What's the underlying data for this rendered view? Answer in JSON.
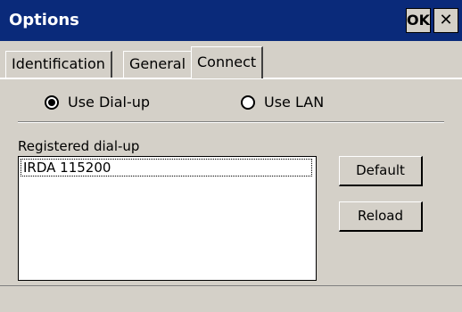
{
  "window": {
    "title": "Options",
    "ok_label": "OK",
    "close_label": "✕"
  },
  "tabs": [
    {
      "label": "Identification",
      "active": false
    },
    {
      "label": "General",
      "active": false
    },
    {
      "label": "Connect",
      "active": true
    }
  ],
  "connection": {
    "options": [
      {
        "label": "Use Dial-up",
        "selected": true
      },
      {
        "label": "Use LAN",
        "selected": false
      }
    ]
  },
  "registered": {
    "label": "Registered dial-up",
    "items": [
      "IRDA 115200"
    ]
  },
  "buttons": {
    "default_label": "Default",
    "reload_label": "Reload"
  }
}
